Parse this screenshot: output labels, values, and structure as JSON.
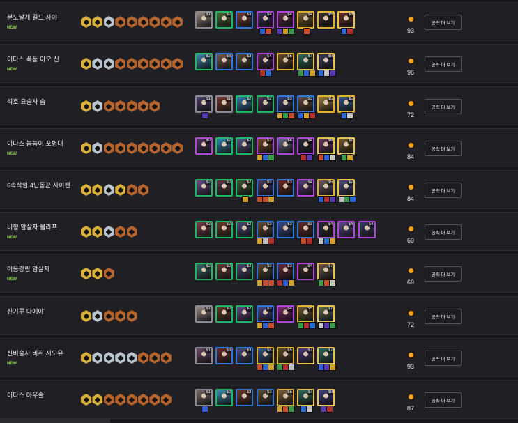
{
  "colors": {
    "background": "#16161a",
    "row": "#1f1f24",
    "new": "#8fd14f",
    "score_dot": "#f4a21a",
    "gold": "#d9b13a",
    "silver": "#b9c4cc",
    "bronze": "#b4642c"
  },
  "guide_label": "공략 더 보기",
  "decks": [
    {
      "name": "분노날개 길드 자야",
      "is_new": true,
      "new_label": "NEW",
      "score": "93",
      "traits": [
        "gold",
        "gold",
        "silver",
        "bronze",
        "bronze",
        "bronze",
        "bronze",
        "bronze",
        "bronze"
      ],
      "units": [
        {
          "cost": "$1",
          "tier": 1,
          "color": "#9a8a80"
        },
        {
          "cost": "$2",
          "tier": 2,
          "color": "#4b6a3a"
        },
        {
          "cost": "$3",
          "tier": 3,
          "color": "#7a3d3a"
        },
        {
          "cost": "$4",
          "tier": 4,
          "color": "#3d2f5a"
        },
        {
          "cost": "$4",
          "tier": 4,
          "color": "#5a2a4a"
        },
        {
          "cost": "$4",
          "tier": 5,
          "color": "#7a5e2a"
        },
        {
          "cost": "$5",
          "tier": 5,
          "color": "#3a2f2a"
        },
        {
          "cost": "$8",
          "tier": 8,
          "color": "#6a2f2a"
        }
      ],
      "items": [
        {
          "unit": 3,
          "colors": [
            "#2e5fd1",
            "#c44e2c"
          ]
        },
        {
          "unit": 4,
          "colors": [
            "#5a3ab1",
            "#d0a02c",
            "#3a9a4a"
          ]
        },
        {
          "unit": 5,
          "colors": [
            "#d04a2c"
          ]
        },
        {
          "unit": 7,
          "colors": [
            "#2a6ad1",
            "#b12e2e"
          ]
        }
      ]
    },
    {
      "name": "이다스 폭풍 아오 신",
      "is_new": true,
      "new_label": "NEW",
      "score": "96",
      "traits": [
        "gold",
        "silver",
        "silver",
        "bronze",
        "bronze",
        "bronze",
        "bronze",
        "bronze",
        "bronze"
      ],
      "units": [
        {
          "cost": "$2",
          "tier": 2,
          "color": "#3a8ab0"
        },
        {
          "cost": "$3",
          "tier": 3,
          "color": "#7a5a4a"
        },
        {
          "cost": "$3",
          "tier": 3,
          "color": "#5a4a3a"
        },
        {
          "cost": "$4",
          "tier": 4,
          "color": "#4a2f4a"
        },
        {
          "cost": "$5",
          "tier": 5,
          "color": "#6a4a2a"
        },
        {
          "cost": "$7",
          "tier": 7,
          "color": "#2f6a5a"
        },
        {
          "cost": "$8",
          "tier": 8,
          "color": "#3a3a5a"
        }
      ],
      "items": [
        {
          "unit": 3,
          "colors": [
            "#b12e2e",
            "#2a6ad1"
          ]
        },
        {
          "unit": 5,
          "colors": [
            "#3a9a4a",
            "#2e5fd1",
            "#d0a02c"
          ]
        },
        {
          "unit": 6,
          "colors": [
            "#2a6ad1",
            "#c4c4c4",
            "#5a3ab1"
          ]
        }
      ]
    },
    {
      "name": "석호 요술사 솜",
      "is_new": false,
      "new_label": "",
      "score": "72",
      "traits": [
        "gold",
        "silver",
        "bronze",
        "bronze",
        "bronze",
        "bronze",
        "bronze"
      ],
      "units": [
        {
          "cost": "$1",
          "tier": 1,
          "color": "#4a3a6a"
        },
        {
          "cost": "$1",
          "tier": 1,
          "color": "#7a3a2a"
        },
        {
          "cost": "$2",
          "tier": 2,
          "color": "#3a7ab0"
        },
        {
          "cost": "$2",
          "tier": 2,
          "color": "#4a3a5a"
        },
        {
          "cost": "$3",
          "tier": 3,
          "color": "#3a3a6a"
        },
        {
          "cost": "$3",
          "tier": 3,
          "color": "#6a4a3a"
        },
        {
          "cost": "$5",
          "tier": 5,
          "color": "#9a7a3a"
        },
        {
          "cost": "$5",
          "tier": 5,
          "color": "#2f5a8a"
        }
      ],
      "items": [
        {
          "unit": 0,
          "colors": [
            "#5a3ab1"
          ]
        },
        {
          "unit": 4,
          "colors": [
            "#d0a02c",
            "#3a9a4a",
            "#c44e2c"
          ]
        },
        {
          "unit": 5,
          "colors": [
            "#2e5fd1",
            "#d0a02c",
            "#b12e2e"
          ]
        },
        {
          "unit": 7,
          "colors": [
            "#2a6ad1",
            "#c4c4c4"
          ]
        }
      ]
    },
    {
      "name": "이다스 늠늠이 포병대",
      "is_new": true,
      "new_label": "NEW",
      "score": "84",
      "traits": [
        "gold",
        "silver",
        "bronze",
        "bronze",
        "bronze",
        "bronze",
        "bronze",
        "bronze",
        "bronze"
      ],
      "units": [
        {
          "cost": "$0",
          "tier": 4,
          "color": "#4a2f5a"
        },
        {
          "cost": "$2",
          "tier": 2,
          "color": "#2f8ab0"
        },
        {
          "cost": "$2",
          "tier": 2,
          "color": "#5a5a8a"
        },
        {
          "cost": "$3",
          "tier": 4,
          "color": "#7a4a2a"
        },
        {
          "cost": "$4",
          "tier": 4,
          "color": "#6a6a8a"
        },
        {
          "cost": "$4",
          "tier": 4,
          "color": "#2a2a3a"
        },
        {
          "cost": "$6",
          "tier": 6,
          "color": "#6a3a5a"
        },
        {
          "cost": "$7",
          "tier": 7,
          "color": "#7a5a2a"
        }
      ],
      "items": [
        {
          "unit": 3,
          "colors": [
            "#d0a02c",
            "#2a6ad1",
            "#3a9a4a"
          ]
        },
        {
          "unit": 5,
          "colors": [
            "#b12e2e",
            "#5a3ab1"
          ]
        },
        {
          "unit": 6,
          "colors": [
            "#c44e2c",
            "#2e5fd1",
            "#c4c4c4"
          ]
        },
        {
          "unit": 7,
          "colors": [
            "#3a9a4a",
            "#d0a02c"
          ]
        }
      ]
    },
    {
      "name": "6속삭임 4난동꾼 사이펜",
      "is_new": false,
      "new_label": "",
      "score": "84",
      "traits": [
        "gold",
        "gold",
        "silver",
        "gold",
        "bronze",
        "bronze"
      ],
      "units": [
        {
          "cost": "$2",
          "tier": 2,
          "color": "#6a4a8a"
        },
        {
          "cost": "$2",
          "tier": 2,
          "color": "#5a3a4a"
        },
        {
          "cost": "$2",
          "tier": 2,
          "color": "#3a5a3a"
        },
        {
          "cost": "$3",
          "tier": 3,
          "color": "#4a3a6a"
        },
        {
          "cost": "$3",
          "tier": 3,
          "color": "#6a2a2a"
        },
        {
          "cost": "$4",
          "tier": 4,
          "color": "#5a3a7a"
        },
        {
          "cost": "$5",
          "tier": 5,
          "color": "#6a5a5a"
        },
        {
          "cost": "$7",
          "tier": 7,
          "color": "#4a4a7a"
        }
      ],
      "items": [
        {
          "unit": 2,
          "colors": [
            "#d0a02c"
          ]
        },
        {
          "unit": 3,
          "colors": [
            "#c44e2c",
            "#c44e2c",
            "#d0a02c"
          ]
        },
        {
          "unit": 6,
          "colors": [
            "#2e5fd1",
            "#b12e2e",
            "#5a3ab1"
          ]
        },
        {
          "unit": 7,
          "colors": [
            "#c4c4c4",
            "#3a9a4a",
            "#2a6ad1"
          ]
        }
      ]
    },
    {
      "name": "비형 암살자 몰라프",
      "is_new": true,
      "new_label": "NEW",
      "score": "69",
      "traits": [
        "gold",
        "gold",
        "silver",
        "bronze",
        "bronze"
      ],
      "units": [
        {
          "cost": "$2",
          "tier": 2,
          "color": "#7a3a4a"
        },
        {
          "cost": "$2",
          "tier": 2,
          "color": "#6a3a2a"
        },
        {
          "cost": "$2",
          "tier": 2,
          "color": "#4a4a7a"
        },
        {
          "cost": "$3",
          "tier": 3,
          "color": "#6a4a3a"
        },
        {
          "cost": "$3",
          "tier": 3,
          "color": "#3a4a8a"
        },
        {
          "cost": "$3",
          "tier": 3,
          "color": "#6a2a2a"
        },
        {
          "cost": "$4",
          "tier": 4,
          "color": "#2a2a2a"
        },
        {
          "cost": "$4",
          "tier": 4,
          "color": "#5a4a8a"
        },
        {
          "cost": "$4",
          "tier": 4,
          "color": "#3a3a6a"
        }
      ],
      "items": [
        {
          "unit": 3,
          "colors": [
            "#d0a02c",
            "#c4c4c4",
            "#b12e2e"
          ]
        },
        {
          "unit": 5,
          "colors": [
            "#c44e2c",
            "#b12e2e"
          ]
        },
        {
          "unit": 6,
          "colors": [
            "#c4c4c4",
            "#2a6ad1",
            "#d0a02c"
          ]
        }
      ]
    },
    {
      "name": "어둠강림 암살자",
      "is_new": true,
      "new_label": "NEW",
      "score": "69",
      "traits": [
        "gold",
        "gold",
        "bronze"
      ],
      "units": [
        {
          "cost": "$2",
          "tier": 2,
          "color": "#3a6a6a"
        },
        {
          "cost": "$2",
          "tier": 2,
          "color": "#6a3a3a"
        },
        {
          "cost": "$2",
          "tier": 2,
          "color": "#4a4a7a"
        },
        {
          "cost": "$3",
          "tier": 3,
          "color": "#5a4a3a"
        },
        {
          "cost": "$3",
          "tier": 3,
          "color": "#6a2a3a"
        },
        {
          "cost": "$4",
          "tier": 4,
          "color": "#3a2a2a"
        },
        {
          "cost": "$7",
          "tier": 7,
          "color": "#6a5a4a"
        }
      ],
      "items": [
        {
          "unit": 3,
          "colors": [
            "#d0a02c",
            "#c44e2c",
            "#c44e2c"
          ]
        },
        {
          "unit": 4,
          "colors": [
            "#b12e2e",
            "#2e5fd1",
            "#d0a02c"
          ]
        },
        {
          "unit": 6,
          "colors": [
            "#3a9a4a",
            "#c44e2c",
            "#c4c4c4"
          ]
        }
      ]
    },
    {
      "name": "신기루 다에야",
      "is_new": false,
      "new_label": "",
      "score": "72",
      "traits": [
        "gold",
        "silver",
        "bronze",
        "bronze",
        "bronze"
      ],
      "units": [
        {
          "cost": "$1",
          "tier": 1,
          "color": "#9a8a8a"
        },
        {
          "cost": "$2",
          "tier": 2,
          "color": "#6a3a2a"
        },
        {
          "cost": "$2",
          "tier": 2,
          "color": "#6a4a8a"
        },
        {
          "cost": "$3",
          "tier": 3,
          "color": "#4a4a8a"
        },
        {
          "cost": "$4",
          "tier": 4,
          "color": "#7a2a6a"
        },
        {
          "cost": "$5",
          "tier": 5,
          "color": "#6a5a3a"
        },
        {
          "cost": "$7",
          "tier": 7,
          "color": "#5a6a4a"
        }
      ],
      "items": [
        {
          "unit": 3,
          "colors": [
            "#d0a02c",
            "#2e5fd1",
            "#c44e2c"
          ]
        },
        {
          "unit": 5,
          "colors": [
            "#3a9a4a",
            "#b12e2e",
            "#2a6ad1"
          ]
        },
        {
          "unit": 6,
          "colors": [
            "#c4c4c4",
            "#5a3ab1",
            "#3a9a4a"
          ]
        }
      ]
    },
    {
      "name": "신비술사 비취 시오유",
      "is_new": true,
      "new_label": "NEW",
      "score": "93",
      "traits": [
        "gold",
        "silver",
        "silver",
        "silver",
        "silver",
        "bronze",
        "bronze",
        "bronze"
      ],
      "units": [
        {
          "cost": "$1",
          "tier": 1,
          "color": "#6a4a6a"
        },
        {
          "cost": "$3",
          "tier": 3,
          "color": "#6a2a2a"
        },
        {
          "cost": "$3",
          "tier": 3,
          "color": "#4a4a7a"
        },
        {
          "cost": "$5",
          "tier": 5,
          "color": "#3a5a8a"
        },
        {
          "cost": "$5",
          "tier": 5,
          "color": "#5a4a2a"
        },
        {
          "cost": "$7",
          "tier": 7,
          "color": "#4a3a7a"
        },
        {
          "cost": "$7",
          "tier": 7,
          "color": "#2f6a5a"
        }
      ],
      "items": [
        {
          "unit": 3,
          "colors": [
            "#c44e2c",
            "#2a6ad1",
            "#d0a02c"
          ]
        },
        {
          "unit": 4,
          "colors": [
            "#3a9a4a",
            "#b12e2e",
            "#c4c4c4"
          ]
        },
        {
          "unit": 6,
          "colors": [
            "#2e5fd1",
            "#5a3ab1",
            "#d0a02c"
          ]
        }
      ]
    },
    {
      "name": "이다스 아우솔",
      "is_new": false,
      "new_label": "",
      "score": "87",
      "traits": [
        "gold",
        "gold",
        "bronze",
        "bronze",
        "bronze",
        "bronze",
        "bronze",
        "bronze"
      ],
      "units": [
        {
          "cost": "$1",
          "tier": 1,
          "color": "#7a6a6a"
        },
        {
          "cost": "$2",
          "tier": 2,
          "color": "#3a8ab0"
        },
        {
          "cost": "$3",
          "tier": 3,
          "color": "#6a3a2a"
        },
        {
          "cost": "$3",
          "tier": 3,
          "color": "#5a4a3a"
        },
        {
          "cost": "$5",
          "tier": 5,
          "color": "#7a5a3a"
        },
        {
          "cost": "$7",
          "tier": 7,
          "color": "#2f6a5a"
        },
        {
          "cost": "$8",
          "tier": 8,
          "color": "#3a3a7a"
        }
      ],
      "items": [
        {
          "unit": 0,
          "colors": [
            "#2e5fd1"
          ]
        },
        {
          "unit": 4,
          "colors": [
            "#d0a02c",
            "#c44e2c",
            "#3a9a4a"
          ]
        },
        {
          "unit": 5,
          "colors": [
            "#2a6ad1",
            "#c4c4c4"
          ]
        },
        {
          "unit": 6,
          "colors": [
            "#5a3ab1",
            "#b12e2e"
          ]
        }
      ]
    }
  ]
}
